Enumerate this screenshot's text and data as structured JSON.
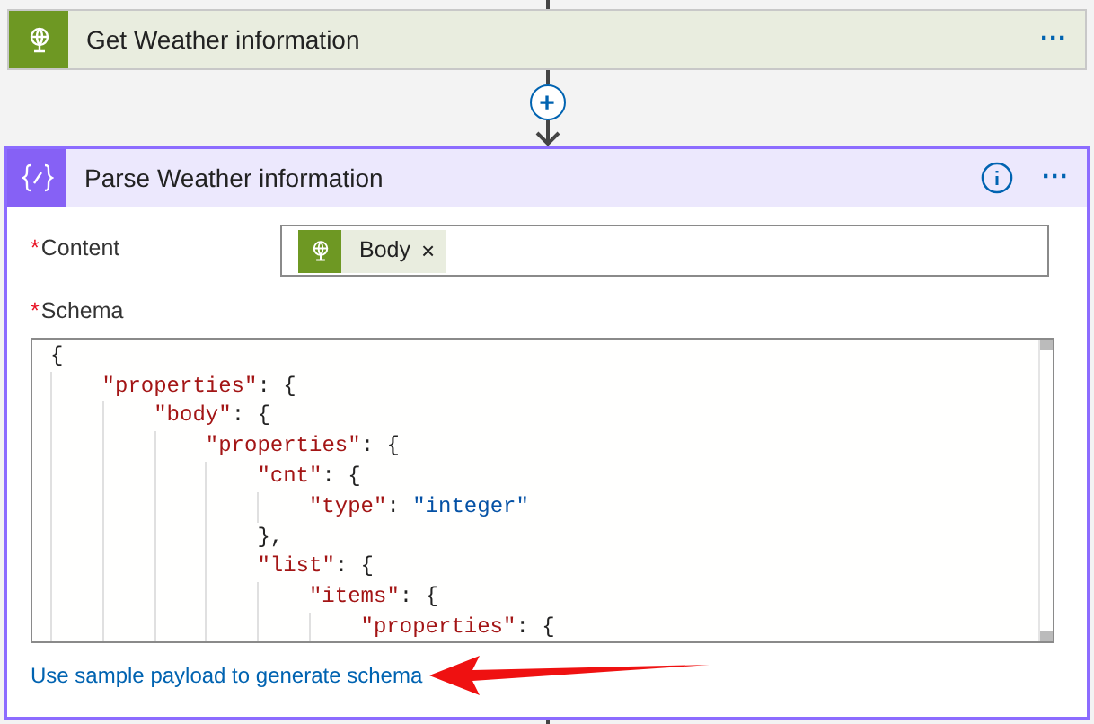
{
  "previous_step": {
    "title": "Get Weather information",
    "menu": "···"
  },
  "add_step": "+",
  "step": {
    "title": "Parse Weather information",
    "menu": "···",
    "fields": [
      {
        "label": "Content",
        "required_mark": "*",
        "kind": "tokens",
        "tokens": [
          {
            "label": "Body",
            "remove": "×"
          }
        ]
      },
      {
        "label": "Schema",
        "required_mark": "*",
        "kind": "code"
      }
    ],
    "code_lines": [
      [
        {
          "kind": "punct",
          "text": "{"
        }
      ],
      [
        {
          "kind": "key",
          "text": "    \"properties\""
        },
        {
          "kind": "punct",
          "text": ": {"
        }
      ],
      [
        {
          "kind": "key",
          "text": "        \"body\""
        },
        {
          "kind": "punct",
          "text": ": {"
        }
      ],
      [
        {
          "kind": "key",
          "text": "            \"properties\""
        },
        {
          "kind": "punct",
          "text": ": {"
        }
      ],
      [
        {
          "kind": "key",
          "text": "                \"cnt\""
        },
        {
          "kind": "punct",
          "text": ": {"
        }
      ],
      [
        {
          "kind": "key",
          "text": "                    \"type\""
        },
        {
          "kind": "punct",
          "text": ": "
        },
        {
          "kind": "value",
          "text": "\"integer\""
        }
      ],
      [
        {
          "kind": "punct",
          "text": "                },"
        }
      ],
      [
        {
          "kind": "key",
          "text": "                \"list\""
        },
        {
          "kind": "punct",
          "text": ": {"
        }
      ],
      [
        {
          "kind": "key",
          "text": "                    \"items\""
        },
        {
          "kind": "punct",
          "text": ": {"
        }
      ],
      [
        {
          "kind": "key",
          "text": "                        \"properties\""
        },
        {
          "kind": "punct",
          "text": ": {"
        }
      ]
    ],
    "link": "Use sample payload to generate schema"
  }
}
